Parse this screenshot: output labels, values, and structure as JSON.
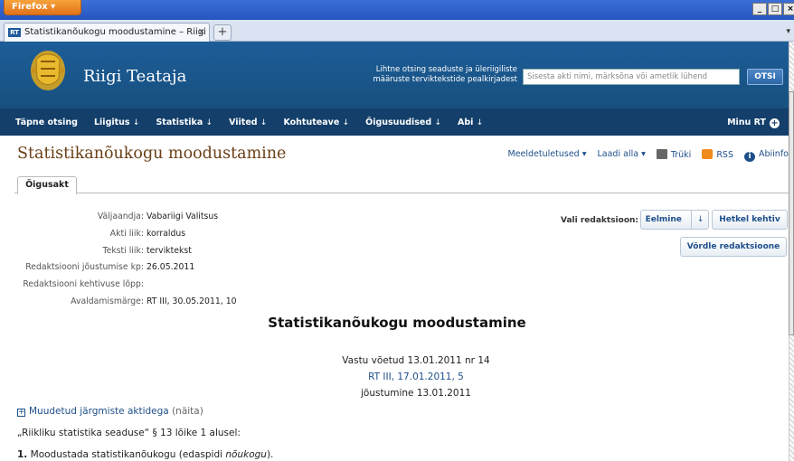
{
  "browser": {
    "menu_button": "Firefox ▾",
    "window_controls": [
      "_",
      "□",
      "×"
    ],
    "tab_title": "Statistikanõukogu moodustamine – Riigi Teat...",
    "tab_favicon": "RT",
    "tab_close": "×",
    "new_tab": "+",
    "tab_scroll": "▾"
  },
  "header": {
    "site_name": "Riigi Teataja",
    "search_hint": "Lihtne otsing seaduste ja üleriigiliste määruste terviktekstide pealkirjadest",
    "search_placeholder": "Sisesta akti nimi, märksõna või ametlik lühend",
    "search_button": "OTSI"
  },
  "nav": {
    "items": [
      {
        "label": "Täpne otsing",
        "arrow": ""
      },
      {
        "label": "Liigitus",
        "arrow": "↓"
      },
      {
        "label": "Statistika",
        "arrow": "↓"
      },
      {
        "label": "Viited",
        "arrow": "↓"
      },
      {
        "label": "Kohtuteave",
        "arrow": "↓"
      },
      {
        "label": "Õigusuudised",
        "arrow": "↓"
      },
      {
        "label": "Abi",
        "arrow": "↓"
      }
    ],
    "my_rt": "Minu RT",
    "my_rt_icon": "+"
  },
  "page": {
    "title": "Statistikanõukogu moodustamine",
    "actions": {
      "reminders": "Meeldetuletused ▾",
      "download": "Laadi alla ▾",
      "print": "Trüki",
      "rss": "RSS",
      "help": "Abiinfo",
      "help_icon": "i"
    },
    "tab": "Õigusakt"
  },
  "meta": [
    {
      "key": "Väljaandja:",
      "value": "Vabariigi Valitsus"
    },
    {
      "key": "Akti liik:",
      "value": "korraldus"
    },
    {
      "key": "Teksti liik:",
      "value": "terviktekst"
    },
    {
      "key": "Redaktsiooni jõustumise kp:",
      "value": "26.05.2011"
    },
    {
      "key": "Redaktsiooni kehtivuse lõpp:",
      "value": ""
    },
    {
      "key": "Avaldamismärge:",
      "value": "RT III, 30.05.2011, 10"
    }
  ],
  "redaction": {
    "label": "Vali redaktsioon:",
    "prev": "Eelmine",
    "prev_arrow": "↓",
    "current": "Hetkel kehtiv",
    "compare": "Võrdle redaktsioone"
  },
  "document": {
    "title": "Statistikanõukogu moodustamine",
    "adopted": "Vastu võetud 13.01.2011 nr 14",
    "publication": "RT III, 17.01.2011, 5",
    "entry_into_force": "jõustumine 13.01.2011",
    "changed_link": "Muudetud järgmiste aktidega",
    "changed_show": "(näita)",
    "changed_icon": "+",
    "basis": "„Riikliku statistika seaduse“ § 13 lõike 1 alusel:",
    "point1_num": "1.",
    "point1_text": "Moodustada statistikanõukogu (edaspidi",
    "point1_italic": "nõukogu",
    "point1_end": ")."
  }
}
